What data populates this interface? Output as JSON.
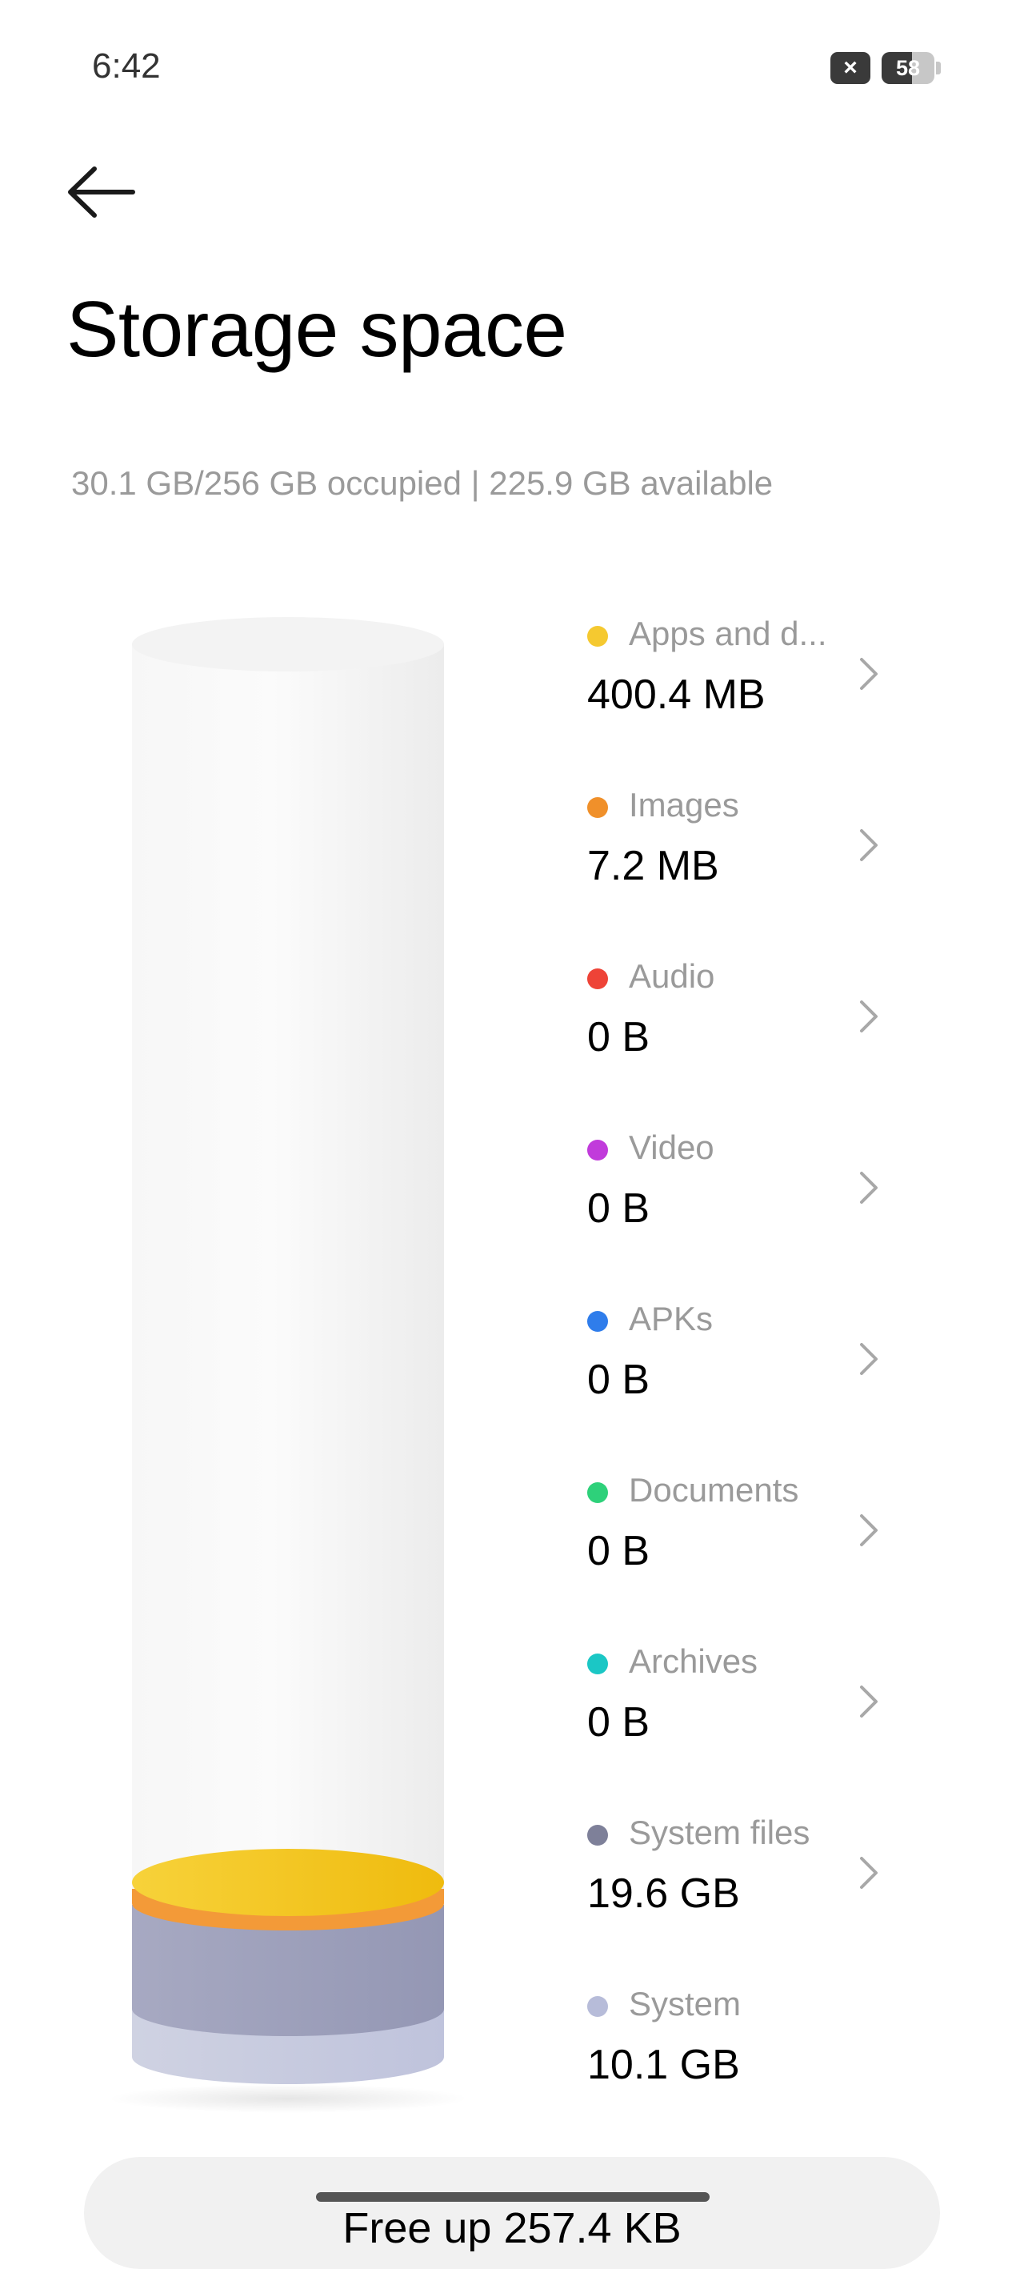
{
  "status_bar": {
    "time": "6:42",
    "close_glyph": "×",
    "battery_level": "58",
    "battery_fraction": 0.58
  },
  "header": {
    "back_icon": "arrow-left-icon",
    "title": "Storage space"
  },
  "summary": "30.1 GB/256 GB occupied | 225.9 GB available",
  "categories": [
    {
      "name": "Apps and d...",
      "size": "400.4 MB",
      "color": "#F5C930",
      "has_chevron": true
    },
    {
      "name": "Images",
      "size": "7.2 MB",
      "color": "#F0902A",
      "has_chevron": true
    },
    {
      "name": "Audio",
      "size": "0 B",
      "color": "#EE4337",
      "has_chevron": true
    },
    {
      "name": "Video",
      "size": "0 B",
      "color": "#C13BDB",
      "has_chevron": true
    },
    {
      "name": "APKs",
      "size": "0 B",
      "color": "#2F7DEB",
      "has_chevron": true
    },
    {
      "name": "Documents",
      "size": "0 B",
      "color": "#2ED17A",
      "has_chevron": true
    },
    {
      "name": "Archives",
      "size": "0 B",
      "color": "#1BC7C5",
      "has_chevron": true
    },
    {
      "name": "System files",
      "size": "19.6 GB",
      "color": "#7E8099",
      "has_chevron": true
    },
    {
      "name": "System",
      "size": "10.1 GB",
      "color": "#B7BCD9",
      "has_chevron": false
    }
  ],
  "action": {
    "label": "Free up 257.4 KB"
  },
  "colors": {
    "title": "#000000",
    "secondary_text": "#9A9A9A",
    "card_background": "#F1F1F1"
  }
}
